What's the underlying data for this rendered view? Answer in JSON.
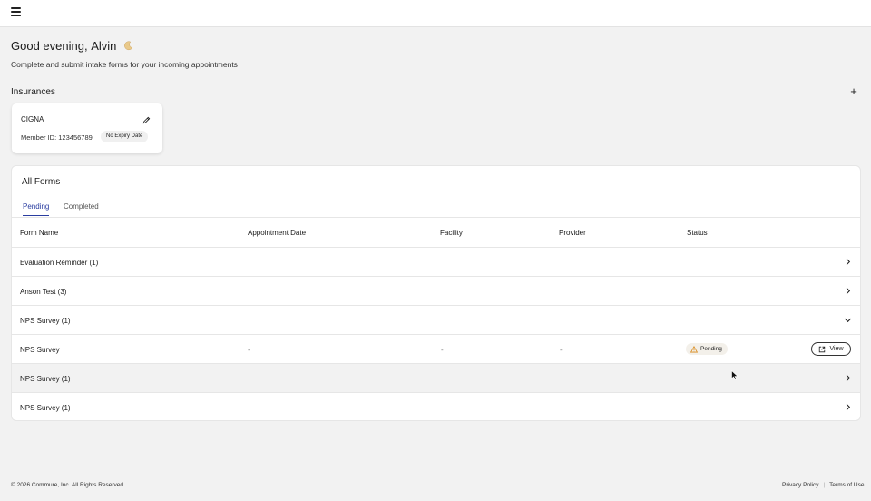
{
  "greeting": {
    "prefix": "Good evening,",
    "name": "Alvin"
  },
  "subtitle": "Complete and submit intake forms for your incoming appointments",
  "insurances": {
    "title": "Insurances",
    "add_icon": "plus-icon",
    "card": {
      "name": "CIGNA",
      "member": "Member ID: 123456789",
      "badge": "No Expiry Date",
      "edit_icon": "pencil-icon"
    }
  },
  "forms": {
    "title": "All Forms",
    "tabs": [
      {
        "label": "Pending",
        "active": true
      },
      {
        "label": "Completed",
        "active": false
      }
    ],
    "columns": [
      "Form Name",
      "Appointment Date",
      "Facility",
      "Provider",
      "Status"
    ],
    "rows": [
      {
        "name": "Evaluation Reminder (1)",
        "icon": "chevron-right-icon"
      },
      {
        "name": "Anson Test (3)",
        "icon": "chevron-right-icon"
      },
      {
        "name": "NPS Survey (1)",
        "icon": "chevron-down-icon"
      },
      {
        "name": "NPS Survey",
        "appointment_date": "-",
        "facility": "-",
        "provider": "-",
        "status": "Pending",
        "status_icon": "warning-icon",
        "action": "View",
        "action_icon": "external-link-icon"
      },
      {
        "name": "NPS Survey (1)",
        "icon": "chevron-right-icon"
      },
      {
        "name": "NPS Survey (1)",
        "icon": "chevron-right-icon"
      }
    ]
  },
  "footer": {
    "copyright": "© 2026 Commure, Inc. All Rights Reserved",
    "privacy": "Privacy Policy",
    "terms": "Terms of Use"
  },
  "colors": {
    "accent": "#2a3da0",
    "background": "#f2f2f2",
    "warning": "#d98a1c"
  }
}
